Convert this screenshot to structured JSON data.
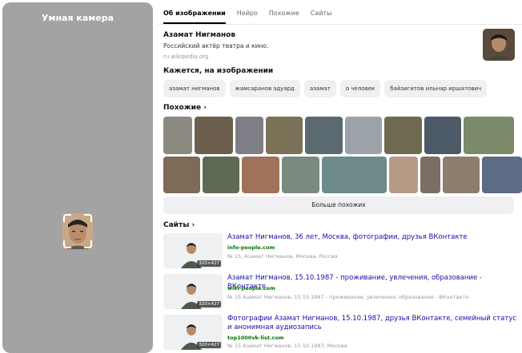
{
  "camera": {
    "title": "Умная камера"
  },
  "tabs": [
    {
      "label": "Об изображении",
      "active": true
    },
    {
      "label": "Нейро",
      "active": false
    },
    {
      "label": "Похожие",
      "active": false
    },
    {
      "label": "Сайты",
      "active": false
    }
  ],
  "person": {
    "name": "Азамат Нигманов",
    "description": "Российский актёр театра и кино.",
    "source": "ru.wikipedia.org"
  },
  "in_image": {
    "heading": "Кажется, на изображении",
    "chips": [
      "азамат нигманов",
      "жамсаранов эдуард",
      "азамат",
      "о человек",
      "байзигитов ильнар иршатович"
    ]
  },
  "similar": {
    "heading": "Похожие",
    "chevron": "›",
    "more_label": "Больше похожих"
  },
  "sites": {
    "heading": "Сайты",
    "chevron": "›",
    "items": [
      {
        "title": "Азамат Нигманов, 36 лет, Москва, фотографии, друзья ВКонтакте",
        "domain": "info-people.com",
        "meta": "№ 15, Азамат Нигманов, Москва, Россия",
        "dims": "320×427"
      },
      {
        "title": "Азамат Нигманов, 15.10.1987 - проживание, увлечения, образование - ВКонтакте",
        "domain": "wiki-people.com",
        "meta": "№ 15 Азамат Нигманов, 15.10.1987 - проживание, увлечения, образование - ВКонтакте",
        "dims": "320×427"
      },
      {
        "title": "Фотографии Азамат Нигманов, 15.10.1987, друзья ВКонтакте, семейный статус и анонимная аудиозапись",
        "domain": "top1000vk-list.com",
        "meta": "№ 15 Азамат Нигманов, 15.10.1987, Москва",
        "dims": "320×427"
      }
    ]
  },
  "colors": {
    "camera_panel": "#a3a3a3",
    "link": "#1a0dab",
    "domain": "#007700",
    "chip_bg": "#f0f0f2"
  }
}
